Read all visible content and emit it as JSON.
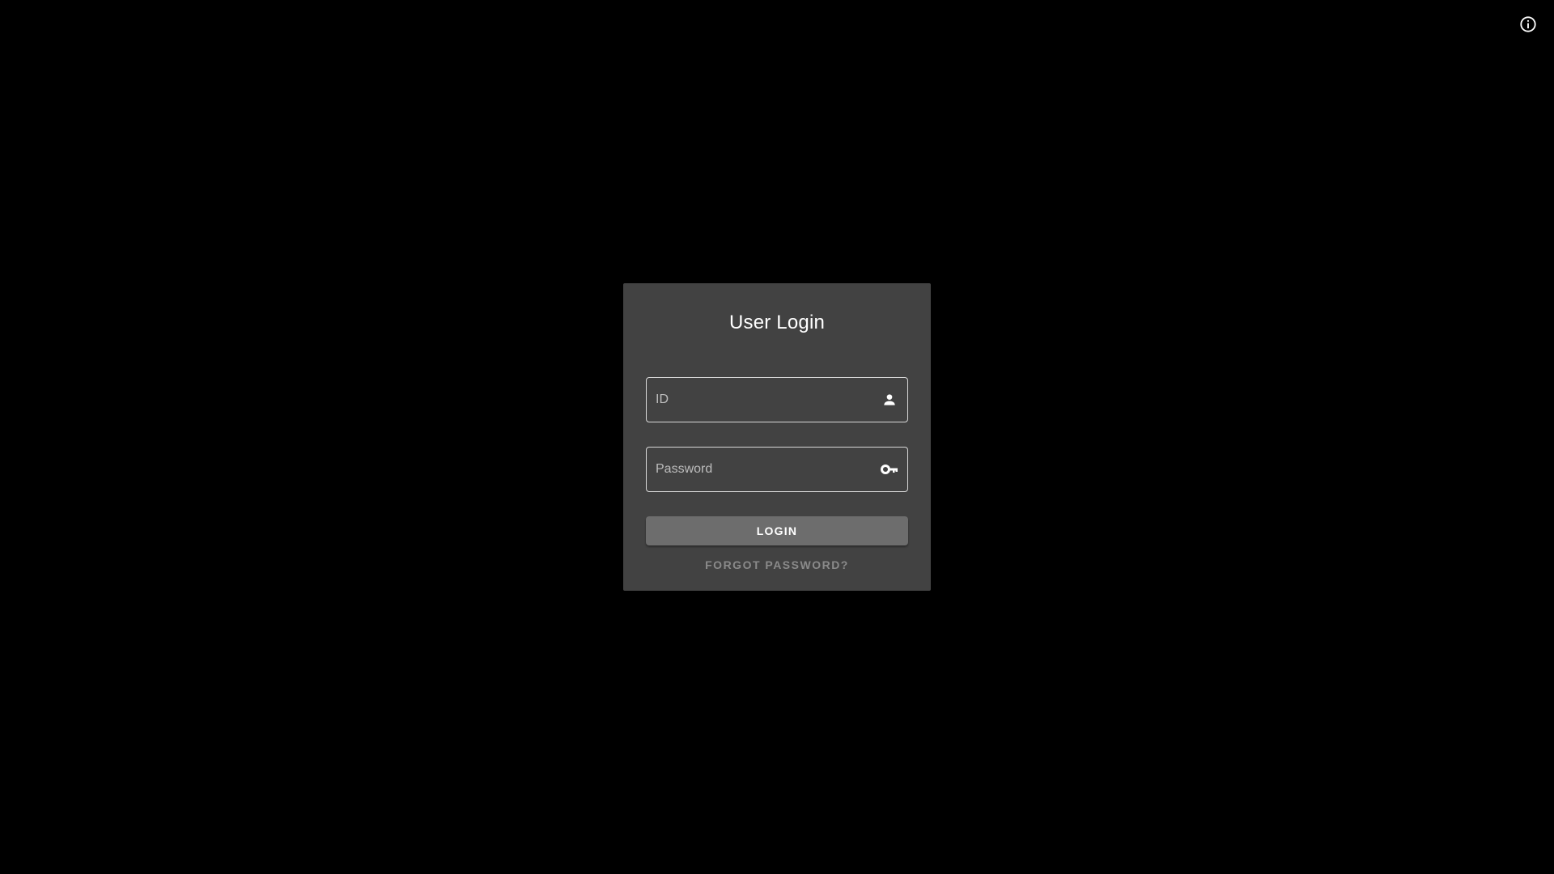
{
  "header": {
    "info_icon": "info-circle-icon"
  },
  "login": {
    "title": "User Login",
    "id_field": {
      "placeholder": "ID",
      "value": "",
      "icon": "person-icon"
    },
    "password_field": {
      "placeholder": "Password",
      "value": "",
      "icon": "key-icon"
    },
    "login_button_label": "LOGIN",
    "forgot_password_label": "FORGOT PASSWORD?"
  },
  "colors": {
    "background": "#000000",
    "card": "#424242",
    "button": "#6d6d6d",
    "link": "#8a8a8a"
  }
}
